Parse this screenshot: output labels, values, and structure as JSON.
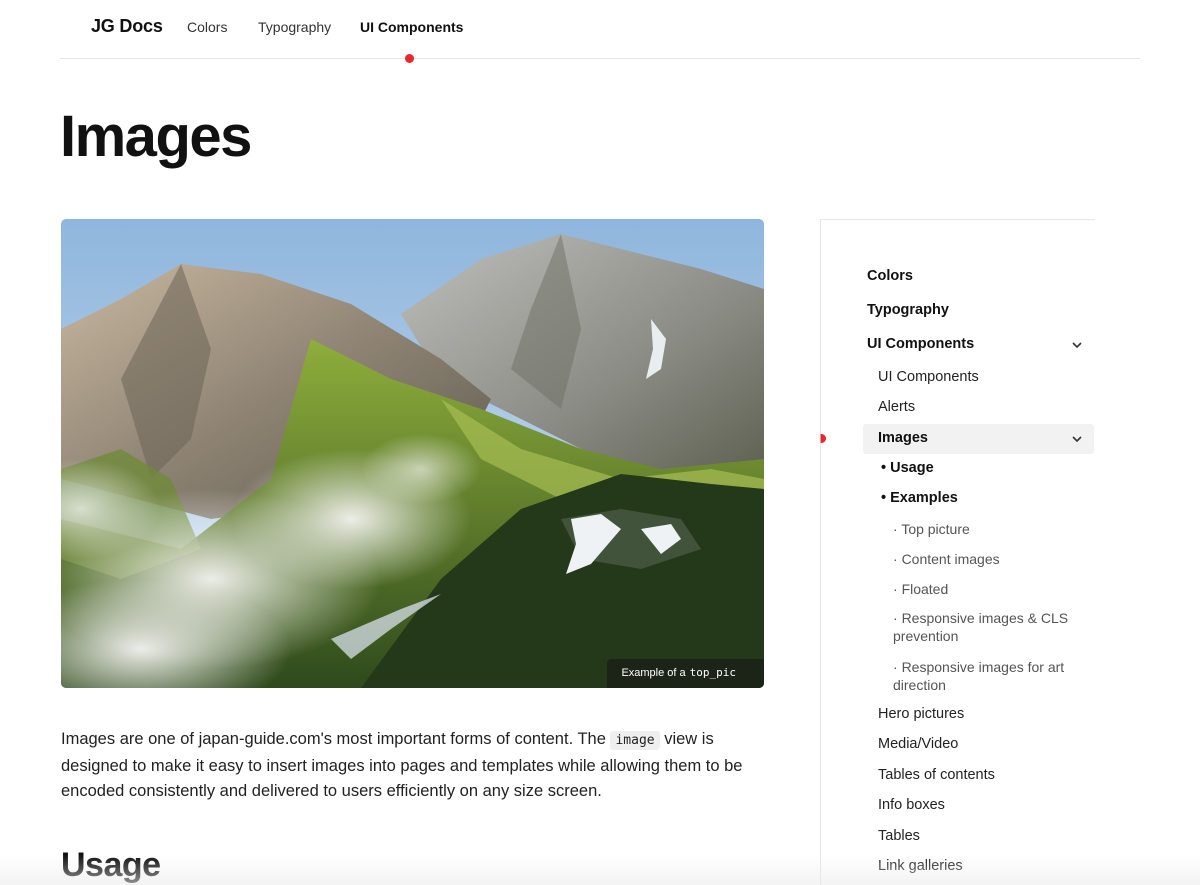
{
  "nav": {
    "brand": "JG Docs",
    "links": [
      "Colors",
      "Typography",
      "UI Components"
    ],
    "active_index": 2
  },
  "page": {
    "title": "Images",
    "hero_caption_prefix": "Example of a",
    "hero_caption_code": "top_pic",
    "intro_before": "Images are one of japan-guide.com's most important forms of content. The",
    "intro_code": "image",
    "intro_after": "view is designed to make it easy to insert images into pages and templates while allowing them to be encoded consistently and delivered to users efficiently on any size screen.",
    "usage_heading": "Usage"
  },
  "sidebar": {
    "top_items": [
      "Colors",
      "Typography",
      "UI Components"
    ],
    "ui_children_before": [
      "UI Components",
      "Alerts"
    ],
    "active_item": "Images",
    "images_sections": [
      "Usage",
      "Examples"
    ],
    "example_items": [
      "Top picture",
      "Content images",
      "Floated",
      "Responsive images & CLS prevention",
      "Responsive images for art direction"
    ],
    "ui_children_after": [
      "Hero pictures",
      "Media/Video",
      "Tables of contents",
      "Info boxes",
      "Tables",
      "Link galleries"
    ]
  },
  "colors": {
    "accent": "#e8262b",
    "text": "#111111",
    "active_bg": "#f2f2f2"
  }
}
